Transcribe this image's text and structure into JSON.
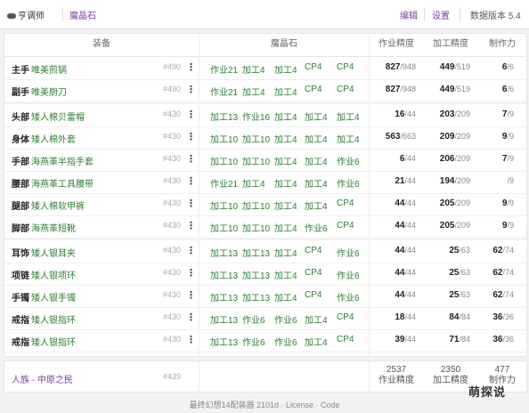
{
  "topbar": {
    "logo": "亨调师",
    "tab": "魔晶石",
    "actions": [
      "编辑",
      "设置"
    ],
    "version": "数据版本 5.4"
  },
  "table": {
    "headers": [
      "装备",
      "魔晶石",
      "作业精度",
      "加工精度",
      "制作力"
    ],
    "rows": [
      {
        "slot": "主手",
        "name": "唯美煎锅",
        "level": "#490",
        "materia": [
          "作业21",
          "加工4",
          "加工4",
          "CP4",
          "CP4"
        ],
        "craftsmanship": "827",
        "craftsmanship_max": "/948",
        "control": "449",
        "control_max": "/519",
        "cp": "6",
        "cp_max": "/6"
      },
      {
        "slot": "副手",
        "name": "唯美厨刀",
        "level": "#490",
        "materia": [
          "作业21",
          "加工4",
          "加工4",
          "CP4",
          "CP4"
        ],
        "craftsmanship": "827",
        "craftsmanship_max": "/948",
        "control": "449",
        "control_max": "/519",
        "cp": "6",
        "cp_max": "/6"
      },
      {
        "slot": "头部",
        "name": "矮人棉贝雷帽",
        "level": "#430",
        "materia": [
          "加工13",
          "作业16",
          "加工4",
          "加工4",
          "加工4"
        ],
        "craftsmanship": "16",
        "craftsmanship_max": "/44",
        "control": "203",
        "control_max": "/209",
        "cp": "7",
        "cp_max": "/9"
      },
      {
        "slot": "身体",
        "name": "矮人棉外套",
        "level": "#430",
        "materia": [
          "加工10",
          "加工10",
          "加工4",
          "加工4",
          "加工4"
        ],
        "craftsmanship": "563",
        "craftsmanship_max": "/663",
        "control": "209",
        "control_max": "/209",
        "cp": "9",
        "cp_max": "/9"
      },
      {
        "slot": "手部",
        "name": "海燕革半指手套",
        "level": "#430",
        "materia": [
          "加工10",
          "加工10",
          "加工4",
          "加工4",
          "作业6"
        ],
        "craftsmanship": "6",
        "craftsmanship_max": "/44",
        "control": "206",
        "control_max": "/209",
        "cp": "7",
        "cp_max": "/9"
      },
      {
        "slot": "腰部",
        "name": "海燕革工具腰带",
        "level": "#430",
        "materia": [
          "作业21",
          "加工4",
          "加工4",
          "加工4",
          "作业6"
        ],
        "craftsmanship": "21",
        "craftsmanship_max": "/44",
        "control": "194",
        "control_max": "/209",
        "cp": "",
        "cp_max": "/9"
      },
      {
        "slot": "腿部",
        "name": "矮人棉软甲裤",
        "level": "#430",
        "materia": [
          "加工10",
          "加工10",
          "加工4",
          "加工4",
          "CP4"
        ],
        "craftsmanship": "44",
        "craftsmanship_max": "/44",
        "control": "205",
        "control_max": "/209",
        "cp": "9",
        "cp_max": "/9"
      },
      {
        "slot": "脚部",
        "name": "海燕革短靴",
        "level": "#430",
        "materia": [
          "加工10",
          "加工10",
          "加工4",
          "作业6",
          "CP4"
        ],
        "craftsmanship": "44",
        "craftsmanship_max": "/44",
        "control": "205",
        "control_max": "/209",
        "cp": "9",
        "cp_max": "/9"
      },
      {
        "slot": "耳饰",
        "name": "矮人银耳夹",
        "level": "#430",
        "materia": [
          "加工13",
          "加工13",
          "加工4",
          "CP4",
          "作业6"
        ],
        "craftsmanship": "44",
        "craftsmanship_max": "/44",
        "control": "25",
        "control_max": "/63",
        "cp": "62",
        "cp_max": "/74"
      },
      {
        "slot": "项链",
        "name": "矮人银项环",
        "level": "#430",
        "materia": [
          "加工13",
          "加工13",
          "加工4",
          "CP4",
          "作业6"
        ],
        "craftsmanship": "44",
        "craftsmanship_max": "/44",
        "control": "25",
        "control_max": "/63",
        "cp": "62",
        "cp_max": "/74"
      },
      {
        "slot": "手镯",
        "name": "矮人银手镯",
        "level": "#430",
        "materia": [
          "加工13",
          "加工13",
          "加工4",
          "CP4",
          "作业6"
        ],
        "craftsmanship": "44",
        "craftsmanship_max": "/44",
        "control": "25",
        "control_max": "/63",
        "cp": "62",
        "cp_max": "/74"
      },
      {
        "slot": "戒指",
        "name": "矮人银指环",
        "level": "#430",
        "materia": [
          "加工13",
          "作业6",
          "作业6",
          "加工4",
          "CP4"
        ],
        "craftsmanship": "18",
        "craftsmanship_max": "/44",
        "control": "84",
        "control_max": "/84",
        "cp": "36",
        "cp_max": "/36"
      },
      {
        "slot": "戒指",
        "name": "矮人银指环",
        "level": "#430",
        "materia": [
          "加工13",
          "作业6",
          "作业6",
          "加工4",
          "CP4"
        ],
        "craftsmanship": "39",
        "craftsmanship_max": "/44",
        "control": "71",
        "control_max": "/84",
        "cp": "36",
        "cp_max": "/36"
      }
    ]
  },
  "summary": {
    "race": "人族 - 中原之民",
    "level": "#439",
    "totals": [
      {
        "value": "2537",
        "label": "作业精度"
      },
      {
        "value": "2350",
        "label": "加工精度"
      },
      {
        "value": "477",
        "label": "制作力"
      }
    ]
  },
  "footer": "最终幻想14配装器 2101d · License · Code",
  "watermark": "萌探说"
}
